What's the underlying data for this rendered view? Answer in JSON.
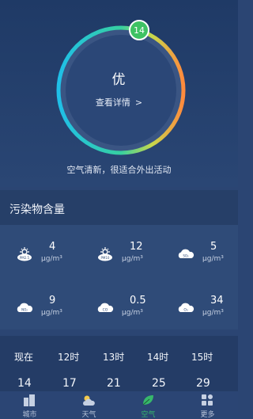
{
  "aqi": {
    "value": "14",
    "level": "优",
    "detail_link": "查看详情",
    "tip": "空气清新，很适合外出活动"
  },
  "pollutants": {
    "title": "污染物含量",
    "items": [
      {
        "name": "PM2.5",
        "icon": "pm25-icon",
        "value": "4",
        "unit": "μg/m³"
      },
      {
        "name": "PM10",
        "icon": "pm10-icon",
        "value": "12",
        "unit": "μg/m³"
      },
      {
        "name": "SO₂",
        "icon": "so2-icon",
        "value": "5",
        "unit": "μg/m³"
      },
      {
        "name": "NO₂",
        "icon": "no2-icon",
        "value": "9",
        "unit": "μg/m³"
      },
      {
        "name": "CO",
        "icon": "co-icon",
        "value": "0.5",
        "unit": "μg/m³"
      },
      {
        "name": "O₃",
        "icon": "o3-icon",
        "value": "34",
        "unit": "μg/m³"
      }
    ]
  },
  "hourly": {
    "hours": [
      "现在",
      "12时",
      "13时",
      "14时",
      "15时"
    ],
    "values": [
      "14",
      "17",
      "21",
      "25",
      "29"
    ]
  },
  "tabs": [
    {
      "label": "城市",
      "icon": "city-icon",
      "active": false
    },
    {
      "label": "天气",
      "icon": "weather-icon",
      "active": false
    },
    {
      "label": "空气",
      "icon": "leaf-icon",
      "active": true
    },
    {
      "label": "更多",
      "icon": "more-icon",
      "active": false
    }
  ],
  "colors": {
    "background": "#2b4573",
    "good": "#3ec263",
    "active_tab": "#37b86b"
  }
}
